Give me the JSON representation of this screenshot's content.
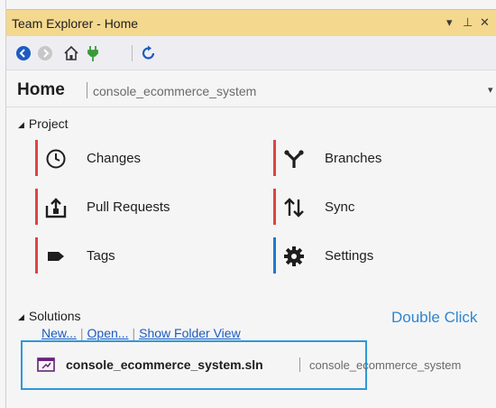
{
  "window": {
    "title": "Team Explorer - Home",
    "controls": [
      "▾",
      "⊥",
      "✕"
    ]
  },
  "toolbar": {
    "items": [
      "back-icon",
      "forward-icon",
      "home-icon",
      "connect-icon",
      "refresh-icon"
    ]
  },
  "home": {
    "title": "Home",
    "repo": "console_ecommerce_system",
    "caret": "▾"
  },
  "project": {
    "header": "Project",
    "items": [
      {
        "label": "Changes",
        "icon": "clock-icon",
        "accent": "#e04343"
      },
      {
        "label": "Pull Requests",
        "icon": "pull-request-icon",
        "accent": "#e04343"
      },
      {
        "label": "Tags",
        "icon": "tag-icon",
        "accent": "#e04343"
      },
      {
        "label": "Branches",
        "icon": "branches-icon",
        "accent": "#e04343"
      },
      {
        "label": "Sync",
        "icon": "sync-icon",
        "accent": "#e04343"
      },
      {
        "label": "Settings",
        "icon": "gear-icon",
        "accent": "#1c7ad2"
      }
    ]
  },
  "solutions": {
    "header": "Solutions",
    "links": [
      "New...",
      "Open...",
      "Show Folder View"
    ],
    "annotation": "Double Click",
    "item": {
      "name": "console_ecommerce_system.sln",
      "repo": "console_ecommerce_system"
    }
  }
}
